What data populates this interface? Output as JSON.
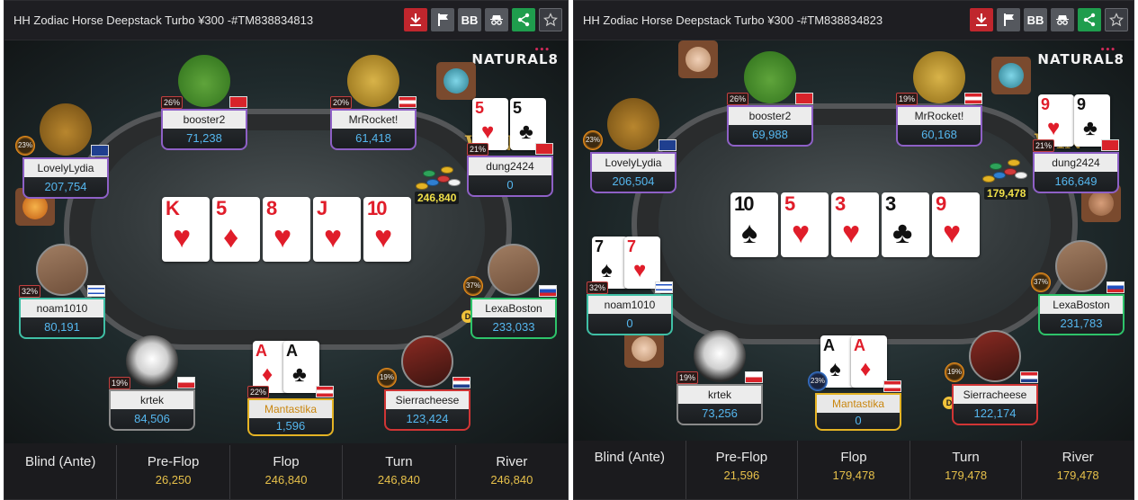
{
  "panels": [
    {
      "title": "HH Zodiac Horse Deepstack Turbo ¥300 -#TM838834813",
      "toolbar": {
        "download_icon": "download-icon",
        "flag_icon": "flag-icon",
        "bb_label": "BB",
        "incognito_icon": "incognito-icon",
        "share_icon": "share-icon",
        "star_icon": "star-icon"
      },
      "logo": "NATURAL8",
      "board": [
        {
          "rank": "K",
          "suit": "♥",
          "color": "red"
        },
        {
          "rank": "5",
          "suit": "♦",
          "color": "red"
        },
        {
          "rank": "8",
          "suit": "♥",
          "color": "red"
        },
        {
          "rank": "J",
          "suit": "♥",
          "color": "red"
        },
        {
          "rank": "10",
          "suit": "♥",
          "color": "red"
        }
      ],
      "pot": "246,840",
      "win_label": "WIN",
      "players": [
        {
          "name": "booster2",
          "stack": "71,238",
          "pct": "26%"
        },
        {
          "name": "MrRocket!",
          "stack": "61,418",
          "pct": "20%"
        },
        {
          "name": "dung2424",
          "stack": "0",
          "pct": "21%"
        },
        {
          "name": "LovelyLydia",
          "stack": "207,754",
          "pct": "23%"
        },
        {
          "name": "noam1010",
          "stack": "80,191",
          "pct": "32%"
        },
        {
          "name": "LexaBoston",
          "stack": "233,033",
          "pct": "37%"
        },
        {
          "name": "krtek",
          "stack": "84,506",
          "pct": "19%"
        },
        {
          "name": "Mantastika",
          "stack": "1,596",
          "pct": "22%"
        },
        {
          "name": "Sierracheese",
          "stack": "123,424",
          "pct": "19%"
        }
      ],
      "hole_cards": {
        "dung2424": [
          {
            "rank": "5",
            "suit": "♥",
            "color": "red"
          },
          {
            "rank": "5",
            "suit": "♣",
            "color": "black"
          }
        ],
        "Mantastika": [
          {
            "rank": "A",
            "suit": "♦",
            "color": "red"
          },
          {
            "rank": "A",
            "suit": "♣",
            "color": "black"
          }
        ]
      },
      "dealer_label": "D",
      "streets": [
        {
          "label": "Blind (Ante)",
          "value": ""
        },
        {
          "label": "Pre-Flop",
          "value": "26,250"
        },
        {
          "label": "Flop",
          "value": "246,840"
        },
        {
          "label": "Turn",
          "value": "246,840"
        },
        {
          "label": "River",
          "value": "246,840"
        }
      ]
    },
    {
      "title": "HH Zodiac Horse Deepstack Turbo ¥300 -#TM838834823",
      "toolbar": {
        "download_icon": "download-icon",
        "flag_icon": "flag-icon",
        "bb_label": "BB",
        "incognito_icon": "incognito-icon",
        "share_icon": "share-icon",
        "star_icon": "star-icon"
      },
      "logo": "NATURAL8",
      "board": [
        {
          "rank": "10",
          "suit": "♠",
          "color": "black"
        },
        {
          "rank": "5",
          "suit": "♥",
          "color": "red"
        },
        {
          "rank": "3",
          "suit": "♥",
          "color": "red"
        },
        {
          "rank": "3",
          "suit": "♣",
          "color": "black"
        },
        {
          "rank": "9",
          "suit": "♥",
          "color": "red"
        }
      ],
      "pot": "179,478",
      "win_label": "WIN",
      "players": [
        {
          "name": "booster2",
          "stack": "69,988",
          "pct": "26%"
        },
        {
          "name": "MrRocket!",
          "stack": "60,168",
          "pct": "19%"
        },
        {
          "name": "dung2424",
          "stack": "166,649",
          "pct": "21%"
        },
        {
          "name": "LovelyLydia",
          "stack": "206,504",
          "pct": "23%"
        },
        {
          "name": "noam1010",
          "stack": "0",
          "pct": "32%"
        },
        {
          "name": "LexaBoston",
          "stack": "231,783",
          "pct": "37%"
        },
        {
          "name": "krtek",
          "stack": "73,256",
          "pct": "19%"
        },
        {
          "name": "Mantastika",
          "stack": "0",
          "pct": "23%"
        },
        {
          "name": "Sierracheese",
          "stack": "122,174",
          "pct": "19%"
        }
      ],
      "hole_cards": {
        "dung2424": [
          {
            "rank": "9",
            "suit": "♥",
            "color": "red"
          },
          {
            "rank": "9",
            "suit": "♣",
            "color": "black"
          }
        ],
        "noam1010": [
          {
            "rank": "7",
            "suit": "♠",
            "color": "black"
          },
          {
            "rank": "7",
            "suit": "♥",
            "color": "red"
          }
        ],
        "Mantastika": [
          {
            "rank": "A",
            "suit": "♠",
            "color": "black"
          },
          {
            "rank": "A",
            "suit": "♦",
            "color": "red"
          }
        ]
      },
      "dealer_label": "D",
      "streets": [
        {
          "label": "Blind (Ante)",
          "value": ""
        },
        {
          "label": "Pre-Flop",
          "value": "21,596"
        },
        {
          "label": "Flop",
          "value": "179,478"
        },
        {
          "label": "Turn",
          "value": "179,478"
        },
        {
          "label": "River",
          "value": "179,478"
        }
      ]
    }
  ]
}
